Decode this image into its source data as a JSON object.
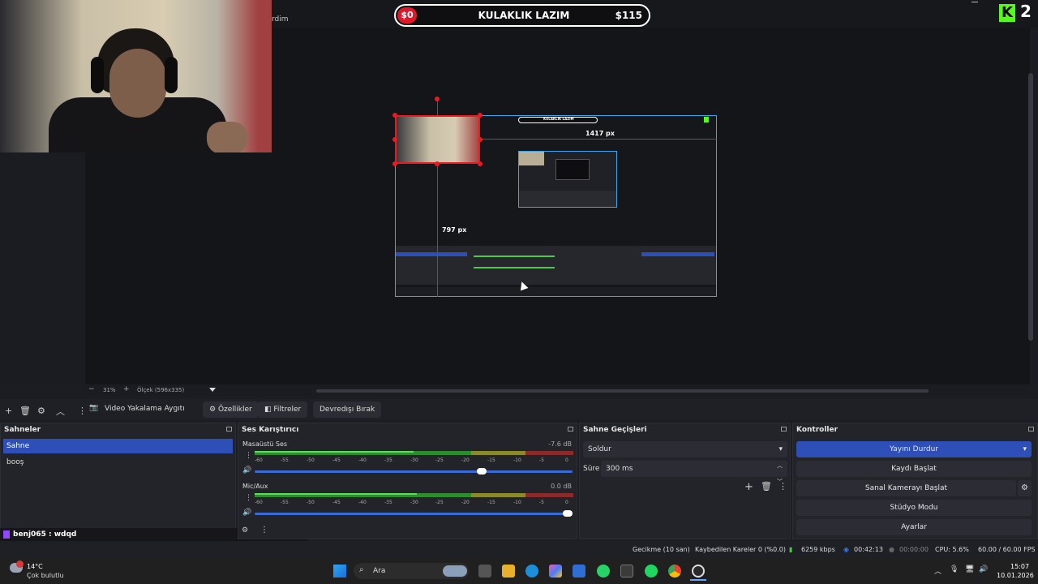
{
  "overlay": {
    "pill_left": "$0",
    "pill_title": "KULAKLIK LAZIM",
    "pill_right": "$115",
    "kick_letter": "K",
    "kick_count": "2",
    "partial_text": "rdim"
  },
  "preview": {
    "measure_width": "1417 px",
    "measure_height": "797 px",
    "zoom_minus": "−",
    "zoom_value": "31%",
    "zoom_plus": "+",
    "scale_label": "Ölçek (596x335)"
  },
  "source_toolbar": {
    "source_name": "Video Yakalama Aygıtı",
    "properties": "Özellikler",
    "filters": "Filtreler",
    "deactivate": "Devredışı Bırak"
  },
  "scenes": {
    "title": "Sahneler",
    "items": [
      {
        "label": "Sahne"
      },
      {
        "label": "booş"
      }
    ]
  },
  "chat": {
    "text": "benj065 : wdqd"
  },
  "mixer": {
    "title": "Ses Karıştırıcı",
    "ticks": [
      "-60",
      "-55",
      "-50",
      "-45",
      "-40",
      "-35",
      "-30",
      "-25",
      "-20",
      "-15",
      "-10",
      "-5",
      "0"
    ],
    "channels": [
      {
        "name": "Masaüstü Ses",
        "db": "-7.6 dB",
        "volume": 0.72
      },
      {
        "name": "Mic/Aux",
        "db": "0.0 dB",
        "volume": 1.0
      }
    ]
  },
  "transitions": {
    "title": "Sahne Geçişleri",
    "selected": "Soldur",
    "duration_label": "Süre",
    "duration_value": "300 ms"
  },
  "controls": {
    "title": "Kontroller",
    "stop_stream": "Yayını Durdur",
    "start_record": "Kaydı Başlat",
    "virtual_cam": "Sanal Kamerayı Başlat",
    "studio_mode": "Stüdyo Modu",
    "settings": "Ayarlar"
  },
  "status": {
    "delay": "Gecikme (10 san)",
    "dropped": "Kaybedilen Kareler 0 (%0.0)",
    "bitrate": "6259 kbps",
    "stream_time": "00:42:13",
    "record_time": "00:00:00",
    "cpu": "CPU: 5.6%",
    "fps": "60.00 / 60.00 FPS"
  },
  "taskbar": {
    "temperature": "14°C",
    "weather": "Çok bulutlu",
    "search": "Ara",
    "time": "15:07",
    "date": "10.01.2026"
  },
  "colors": {
    "accent": "#2e4fb7",
    "kick_green": "#53fc18",
    "guide_red": "#e81b23",
    "preview_border": "#3ba6ee"
  }
}
